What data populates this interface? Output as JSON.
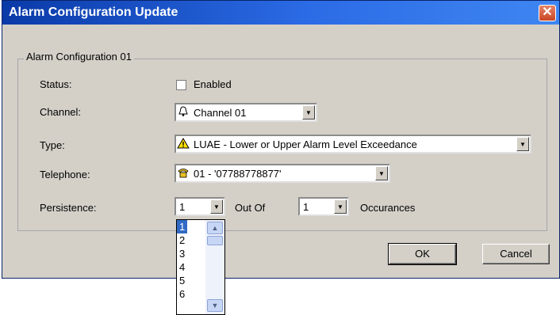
{
  "window": {
    "title": "Alarm Configuration Update",
    "close_glyph": "✕"
  },
  "group": {
    "legend": "Alarm Configuration 01"
  },
  "fields": {
    "status_label": "Status:",
    "status_checkbox_label": "Enabled",
    "status_checked": false,
    "channel_label": "Channel:",
    "channel_value": "Channel 01",
    "type_label": "Type:",
    "type_value": "LUAE - Lower or Upper Alarm Level Exceedance",
    "telephone_label": "Telephone:",
    "telephone_value": "01  -  '07788778877'",
    "persistence_label": "Persistence:",
    "persistence_value": "1",
    "out_of_label": "Out Of",
    "out_of_value": "1",
    "occurances_label": "Occurances"
  },
  "buttons": {
    "ok": "OK",
    "cancel": "Cancel"
  },
  "dropdown": {
    "items": [
      "1",
      "2",
      "3",
      "4",
      "5",
      "6"
    ],
    "selected": "1"
  },
  "icons": {
    "channel": "bell-icon",
    "type": "warning-icon",
    "telephone": "phone-icon",
    "dropdown_arrow": "chevron-down-icon",
    "scroll_up": "chevron-up-icon",
    "scroll_down": "chevron-down-icon"
  },
  "colors": {
    "title_bar": "#0a3aa8",
    "dialog_bg": "#d4d0c8",
    "selection": "#316ac5",
    "close_button": "#c94523"
  }
}
